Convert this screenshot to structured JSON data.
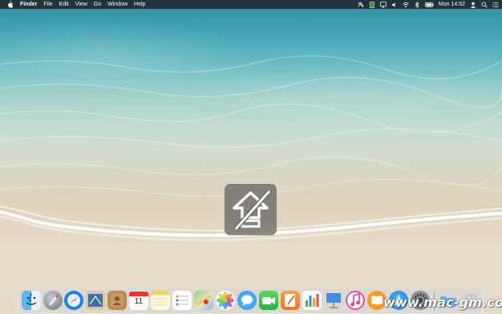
{
  "menubar": {
    "app_name": "Finder",
    "items": [
      "File",
      "Edit",
      "View",
      "Go",
      "Window",
      "Help"
    ],
    "status_icons": [
      "no-wifi-sync-icon",
      "battery-app-icon",
      "airplay-icon",
      "volume-icon",
      "wifi-icon",
      "bluetooth-icon",
      "battery-icon"
    ],
    "clock": "Mon 14:52",
    "right_icons": [
      "user-icon",
      "spotlight-icon",
      "notification-center-icon"
    ]
  },
  "hud": {
    "icon": "caps-lock-off-icon"
  },
  "dock": {
    "apps": [
      "finder-icon",
      "launchpad-icon",
      "safari-icon",
      "mail-icon",
      "contacts-icon",
      "calendar-icon",
      "notes-icon",
      "reminders-icon",
      "maps-icon",
      "photos-icon",
      "messages-icon",
      "facetime-icon",
      "pages-icon",
      "numbers-icon",
      "keynote-icon",
      "itunes-icon",
      "ibooks-icon",
      "app-store-icon",
      "system-preferences-icon",
      "downloads-folder-icon",
      "trash-icon"
    ],
    "calendar_day": "11"
  },
  "watermark": "www.mac-gm.com",
  "colors": {
    "menubar": "#1e2024",
    "accent": "#0a7cff"
  }
}
